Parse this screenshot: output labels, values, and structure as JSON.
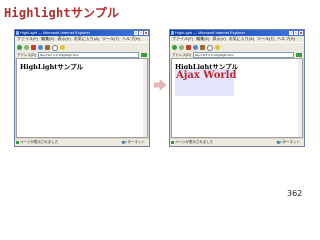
{
  "slide": {
    "title": "Highlightサンプル",
    "page_number": "362"
  },
  "browser_left": {
    "title": "HighLight — Microsoft Internet Explorer",
    "menu": [
      "ファイル(F)",
      "編集(E)",
      "表示(V)",
      "お気に入り(A)",
      "ツール(T)",
      "ヘルプ(H)"
    ],
    "address_label": "アドレス(D)",
    "address_value": "http://127.0.0.1/highlight.html",
    "content_heading": "HighLightサンプル",
    "status_left": "ページが表示されました",
    "status_right": "インターネット"
  },
  "browser_right": {
    "title": "HighLight — Microsoft Internet Explorer",
    "menu": [
      "ファイル(F)",
      "編集(E)",
      "表示(V)",
      "お気に入り(A)",
      "ツール(T)",
      "ヘルプ(H)"
    ],
    "address_label": "アドレス(D)",
    "address_value": "http://127.0.0.1/highlight.html",
    "content_heading": "HighLightサンプル",
    "highlight_text": "Ajax World",
    "status_left": "ページが表示されました",
    "status_right": "インターネット"
  },
  "colors": {
    "slide_title": "#b12d2d",
    "highlight_bg": "#e4e4ff",
    "highlight_text": "#c02828",
    "arrow": "#e8b7b7"
  },
  "icons": {
    "arrow": "right-arrow-icon"
  }
}
